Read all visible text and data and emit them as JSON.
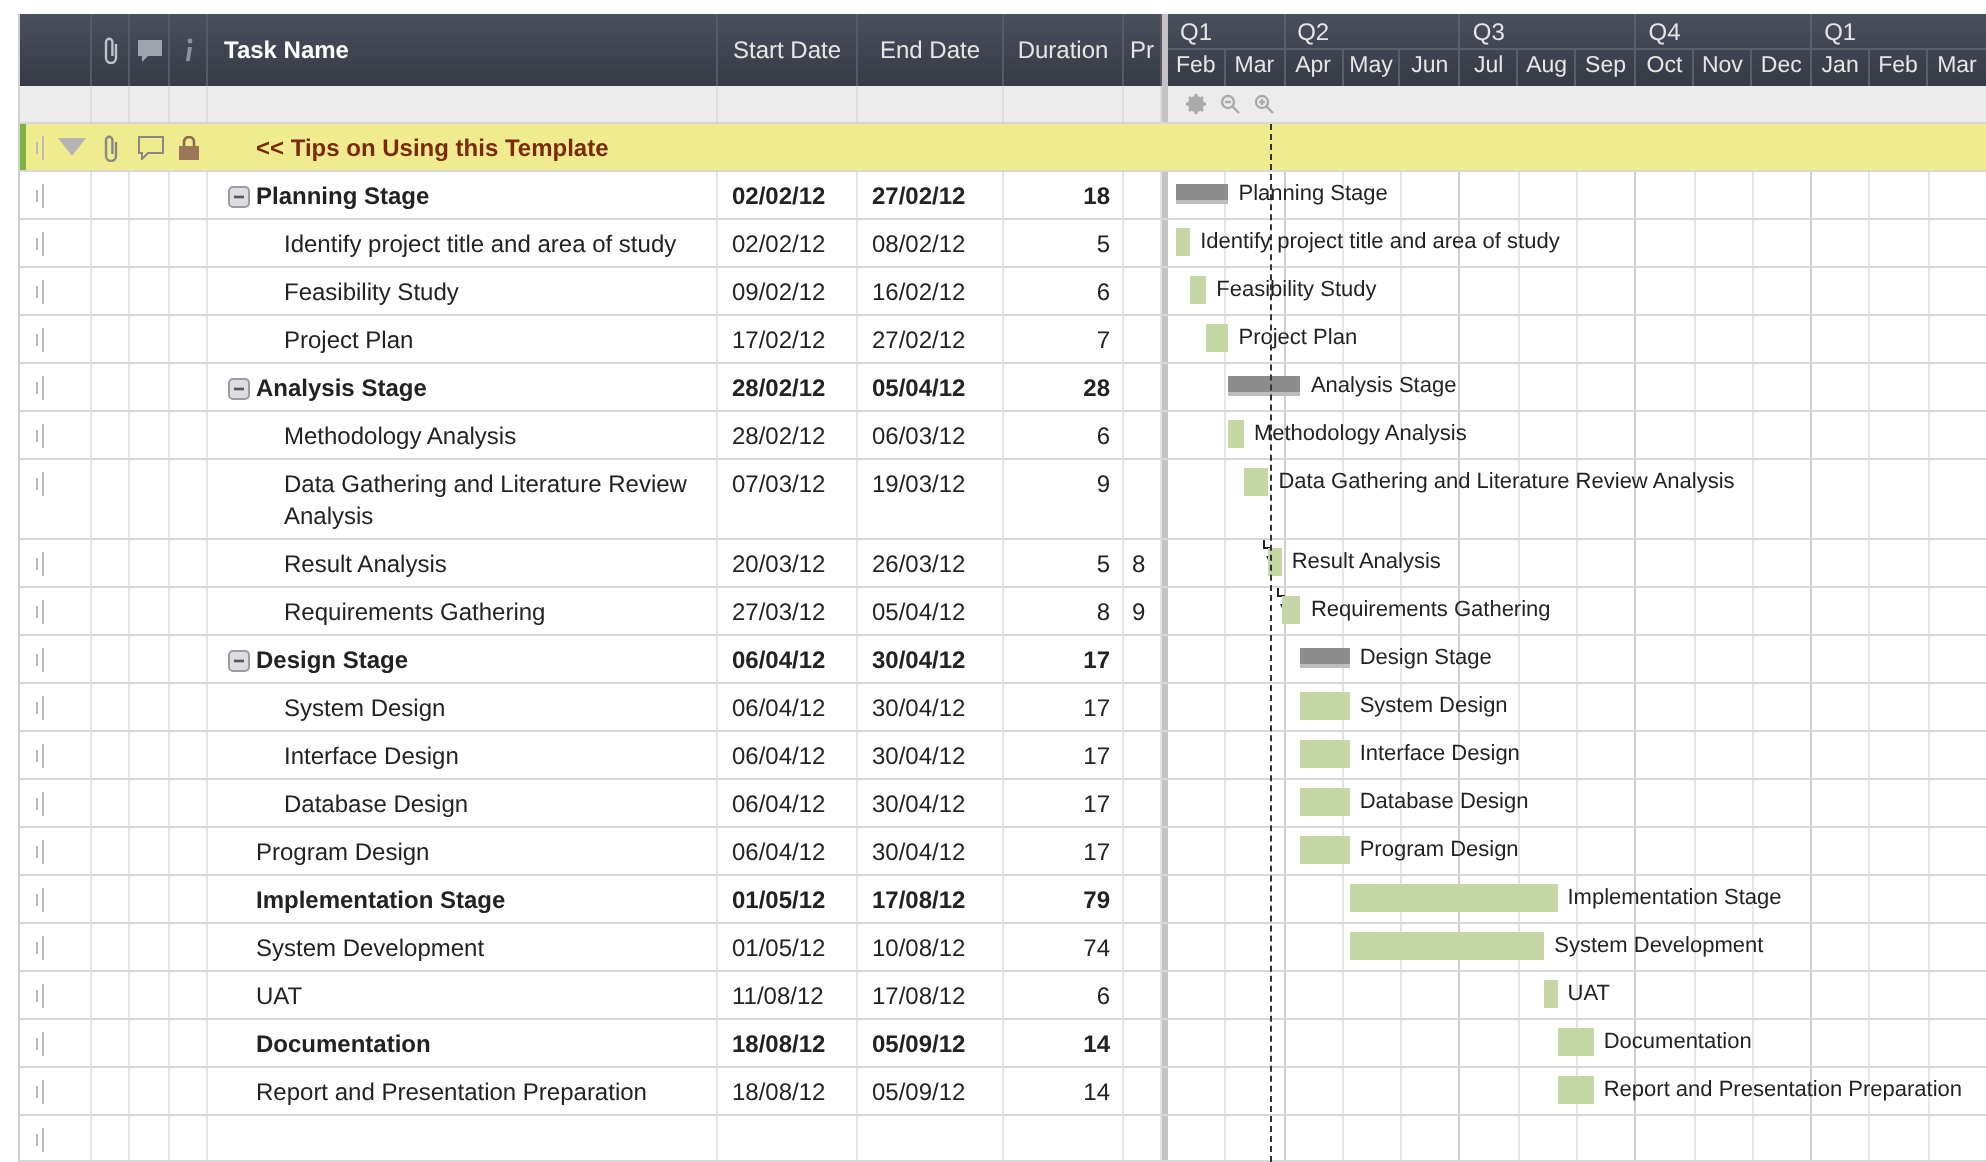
{
  "columns": {
    "task_name": "Task Name",
    "start_date": "Start Date",
    "end_date": "End Date",
    "duration": "Duration",
    "column_9": "Pr"
  },
  "timeline": {
    "quarters": [
      {
        "label": "Q1",
        "months": [
          "Feb",
          "Mar"
        ]
      },
      {
        "label": "Q2",
        "months": [
          "Apr",
          "May",
          "Jun"
        ]
      },
      {
        "label": "Q3",
        "months": [
          "Jul",
          "Aug",
          "Sep"
        ]
      },
      {
        "label": "Q4",
        "months": [
          "Oct",
          "Nov",
          "Dec"
        ]
      },
      {
        "label": "Q1",
        "months": [
          "Jan",
          "Feb",
          "Mar"
        ]
      }
    ]
  },
  "tips_row": {
    "label": "<< Tips on Using this Template"
  },
  "tasks": [
    {
      "name": "Planning Stage",
      "start": "02/02/12",
      "end": "27/02/12",
      "duration": "18",
      "bold": true,
      "expanded": true,
      "kind": "summary",
      "bar_label": "Planning Stage",
      "children": [
        {
          "name": "Identify project title and area of study",
          "start": "02/02/12",
          "end": "08/02/12",
          "duration": "5",
          "bold": false,
          "kind": "task",
          "bar_label": "Identify project title and area of study"
        },
        {
          "name": "Feasibility Study",
          "start": "09/02/12",
          "end": "16/02/12",
          "duration": "6",
          "bold": false,
          "kind": "task",
          "bar_label": "Feasibility Study"
        },
        {
          "name": "Project Plan",
          "start": "17/02/12",
          "end": "27/02/12",
          "duration": "7",
          "bold": false,
          "kind": "task",
          "bar_label": "Project Plan"
        }
      ]
    },
    {
      "name": "Analysis Stage",
      "start": "28/02/12",
      "end": "05/04/12",
      "duration": "28",
      "bold": true,
      "expanded": true,
      "kind": "summary",
      "bar_label": "Analysis Stage",
      "children": [
        {
          "name": "Methodology Analysis",
          "start": "28/02/12",
          "end": "06/03/12",
          "duration": "6",
          "bold": false,
          "kind": "task",
          "bar_label": "Methodology Analysis"
        },
        {
          "name": "Data Gathering and Literature Review Analysis",
          "start": "07/03/12",
          "end": "19/03/12",
          "duration": "9",
          "bold": false,
          "kind": "task",
          "bar_label": "Data Gathering and Literature Review Analysis"
        },
        {
          "name": "Result Analysis",
          "start": "20/03/12",
          "end": "26/03/12",
          "duration": "5",
          "predecessors": "8",
          "bold": false,
          "kind": "task",
          "bar_label": "Result Analysis"
        },
        {
          "name": "Requirements Gathering",
          "start": "27/03/12",
          "end": "05/04/12",
          "duration": "8",
          "predecessors": "9",
          "bold": false,
          "kind": "task",
          "bar_label": "Requirements Gathering"
        }
      ]
    },
    {
      "name": "Design Stage",
      "start": "06/04/12",
      "end": "30/04/12",
      "duration": "17",
      "bold": true,
      "expanded": true,
      "kind": "summary",
      "bar_label": "Design Stage",
      "children": [
        {
          "name": "System Design",
          "start": "06/04/12",
          "end": "30/04/12",
          "duration": "17",
          "bold": false,
          "kind": "task",
          "bar_label": "System Design"
        },
        {
          "name": "Interface Design",
          "start": "06/04/12",
          "end": "30/04/12",
          "duration": "17",
          "bold": false,
          "kind": "task",
          "bar_label": "Interface Design"
        },
        {
          "name": "Database Design",
          "start": "06/04/12",
          "end": "30/04/12",
          "duration": "17",
          "bold": false,
          "kind": "task",
          "bar_label": "Database Design"
        }
      ]
    },
    {
      "name": "Program Design",
      "start": "06/04/12",
      "end": "30/04/12",
      "duration": "17",
      "bold": false,
      "kind": "task",
      "bar_label": "Program Design"
    },
    {
      "name": "Implementation Stage",
      "start": "01/05/12",
      "end": "17/08/12",
      "duration": "79",
      "bold": true,
      "kind": "task",
      "bar_label": "Implementation Stage"
    },
    {
      "name": "System Development",
      "start": "01/05/12",
      "end": "10/08/12",
      "duration": "74",
      "bold": false,
      "kind": "task",
      "bar_label": "System Development"
    },
    {
      "name": "UAT",
      "start": "11/08/12",
      "end": "17/08/12",
      "duration": "6",
      "bold": false,
      "kind": "task",
      "bar_label": "UAT"
    },
    {
      "name": "Documentation",
      "start": "18/08/12",
      "end": "05/09/12",
      "duration": "14",
      "bold": true,
      "kind": "task",
      "bar_label": "Documentation"
    },
    {
      "name": "Report and Presentation Preparation",
      "start": "18/08/12",
      "end": "05/09/12",
      "duration": "14",
      "bold": false,
      "kind": "task",
      "bar_label": "Report and Presentation Preparation"
    }
  ]
}
